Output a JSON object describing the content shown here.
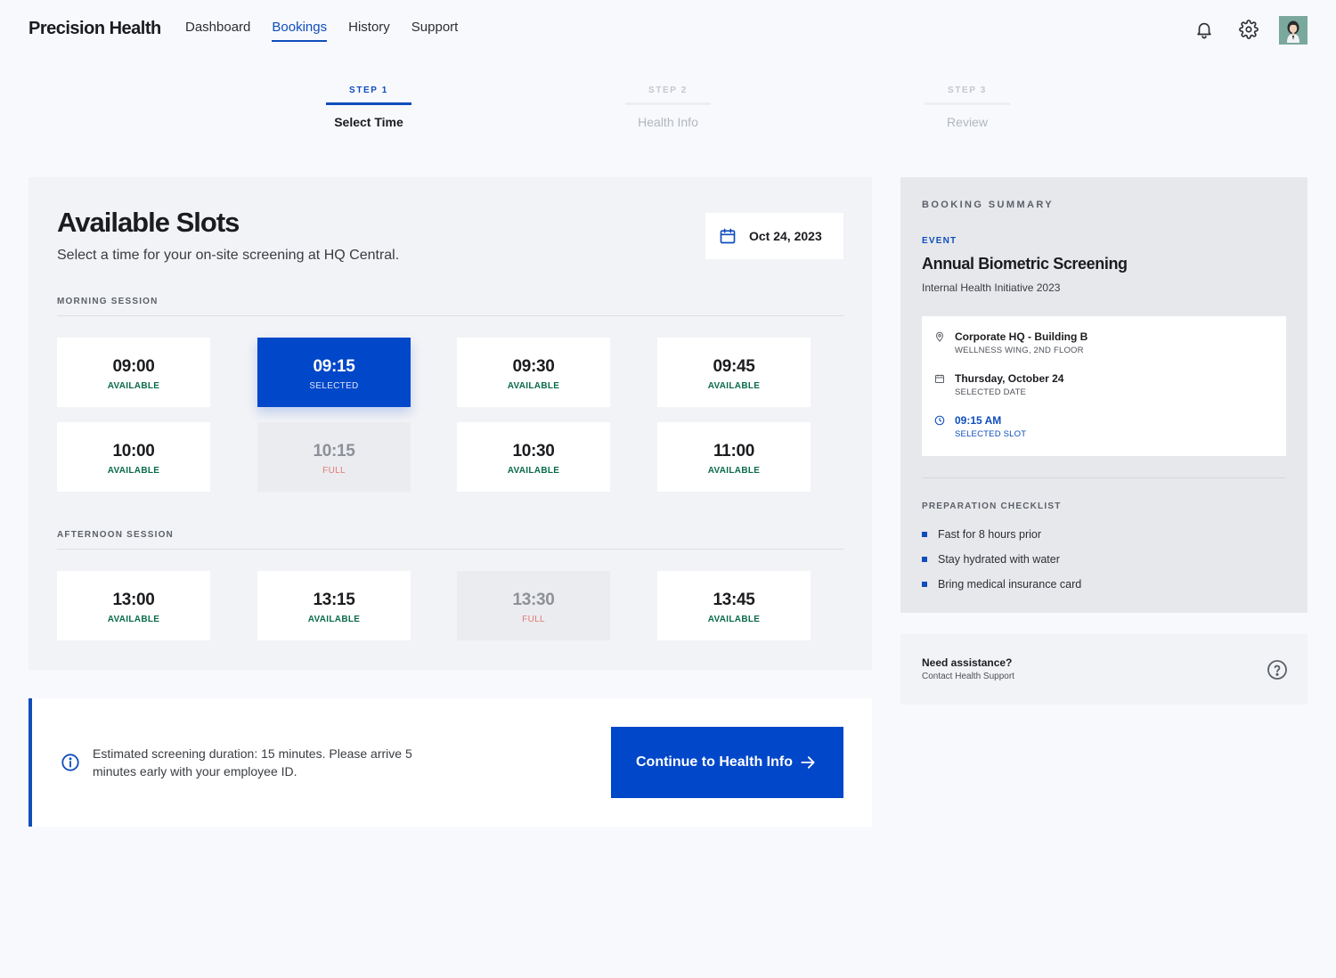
{
  "header": {
    "brand": "Precision Health",
    "nav": [
      {
        "label": "Dashboard",
        "active": false
      },
      {
        "label": "Bookings",
        "active": true
      },
      {
        "label": "History",
        "active": false
      },
      {
        "label": "Support",
        "active": false
      }
    ],
    "icons": [
      "bell-icon",
      "gear-icon",
      "avatar"
    ]
  },
  "stepper": [
    {
      "number": "STEP 1",
      "label": "Select Time",
      "active": true
    },
    {
      "number": "STEP 2",
      "label": "Health Info",
      "active": false
    },
    {
      "number": "STEP 3",
      "label": "Review",
      "active": false
    }
  ],
  "slots": {
    "title": "Available Slots",
    "subtitle": "Select a time for your on-site screening at HQ Central.",
    "date": "Oct 24, 2023",
    "morning": {
      "label": "MORNING SESSION",
      "slots": [
        {
          "time": "09:00",
          "status": "AVAILABLE",
          "state": "available"
        },
        {
          "time": "09:15",
          "status": "SELECTED",
          "state": "selected"
        },
        {
          "time": "09:30",
          "status": "AVAILABLE",
          "state": "available"
        },
        {
          "time": "09:45",
          "status": "AVAILABLE",
          "state": "available"
        },
        {
          "time": "10:00",
          "status": "AVAILABLE",
          "state": "available"
        },
        {
          "time": "10:15",
          "status": "FULL",
          "state": "full"
        },
        {
          "time": "10:30",
          "status": "AVAILABLE",
          "state": "available"
        },
        {
          "time": "11:00",
          "status": "AVAILABLE",
          "state": "available"
        }
      ]
    },
    "afternoon": {
      "label": "AFTERNOON SESSION",
      "slots": [
        {
          "time": "13:00",
          "status": "AVAILABLE",
          "state": "available"
        },
        {
          "time": "13:15",
          "status": "AVAILABLE",
          "state": "available"
        },
        {
          "time": "13:30",
          "status": "FULL",
          "state": "full"
        },
        {
          "time": "13:45",
          "status": "AVAILABLE",
          "state": "available"
        }
      ]
    }
  },
  "info_bar": {
    "text": "Estimated screening duration: 15 minutes. Please arrive 5 minutes early with your employee ID.",
    "cta_label": "Continue to Health Info"
  },
  "summary": {
    "title": "BOOKING SUMMARY",
    "event_label": "EVENT",
    "event_name": "Annual Biometric Screening",
    "event_sub": "Internal Health Initiative 2023",
    "location_main": "Corporate HQ - Building B",
    "location_sub": "WELLNESS WING, 2ND FLOOR",
    "date_main": "Thursday, October 24",
    "date_sub": "SELECTED DATE",
    "time_main": "09:15 AM",
    "time_sub": "SELECTED SLOT",
    "checklist_title": "PREPARATION CHECKLIST",
    "checklist": [
      "Fast for 8 hours prior",
      "Stay hydrated with water",
      "Bring medical insurance card"
    ]
  },
  "assist": {
    "title": "Need assistance?",
    "subtitle": "Contact Health Support"
  },
  "colors": {
    "accent": "#0047c9",
    "available_text": "#0a6b4c",
    "full_text": "#e07a76",
    "page_bg": "#f8f9fc"
  }
}
